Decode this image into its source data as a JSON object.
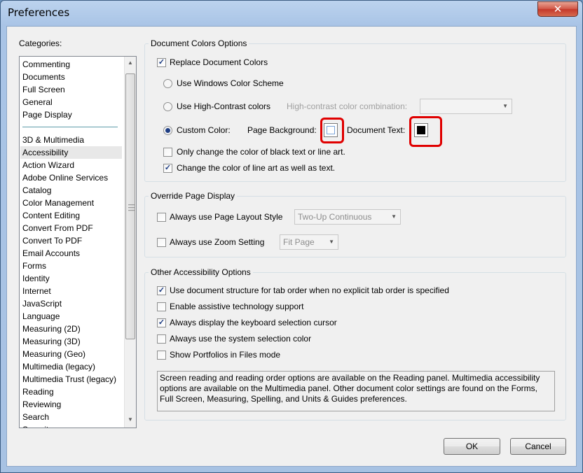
{
  "window": {
    "title": "Preferences",
    "close_glyph": "✕"
  },
  "categories": {
    "label": "Categories:",
    "group1": [
      "Commenting",
      "Documents",
      "Full Screen",
      "General",
      "Page Display"
    ],
    "group2": [
      "3D & Multimedia",
      "Accessibility",
      "Action Wizard",
      "Adobe Online Services",
      "Catalog",
      "Color Management",
      "Content Editing",
      "Convert From PDF",
      "Convert To PDF",
      "Email Accounts",
      "Forms",
      "Identity",
      "Internet",
      "JavaScript",
      "Language",
      "Measuring (2D)",
      "Measuring (3D)",
      "Measuring (Geo)",
      "Multimedia (legacy)",
      "Multimedia Trust (legacy)",
      "Reading",
      "Reviewing",
      "Search",
      "Security"
    ],
    "selected": "Accessibility"
  },
  "doc_colors": {
    "title": "Document Colors Options",
    "replace": {
      "label": "Replace Document Colors",
      "checked": true
    },
    "windows_scheme": {
      "label": "Use Windows Color Scheme",
      "selected": false
    },
    "high_contrast": {
      "label": "Use High-Contrast colors",
      "selected": false
    },
    "hc_combo_label": "High-contrast color combination:",
    "hc_combo_value": "",
    "custom": {
      "label": "Custom Color:",
      "selected": true
    },
    "page_bg_label": "Page Background:",
    "page_bg_color": "#ffffff",
    "doc_text_label": "Document Text:",
    "doc_text_color": "#000000",
    "only_black": {
      "label": "Only change the color of black text or line art.",
      "checked": false
    },
    "line_art": {
      "label": "Change the color of line art as well as text.",
      "checked": true
    }
  },
  "override": {
    "title": "Override Page Display",
    "page_layout": {
      "label": "Always use Page Layout Style",
      "checked": false,
      "value": "Two-Up Continuous"
    },
    "zoom": {
      "label": "Always use Zoom Setting",
      "checked": false,
      "value": "Fit Page"
    }
  },
  "other": {
    "title": "Other Accessibility Options",
    "options": [
      {
        "label": "Use document structure for tab order when no explicit tab order is specified",
        "checked": true
      },
      {
        "label": "Enable assistive technology support",
        "checked": false
      },
      {
        "label": "Always display the keyboard selection cursor",
        "checked": true
      },
      {
        "label": "Always use the system selection color",
        "checked": false
      },
      {
        "label": "Show Portfolios in Files mode",
        "checked": false
      }
    ],
    "note": "Screen reading and reading order options are available on the Reading panel. Multimedia accessibility options are available on the Multimedia panel. Other document color settings are found on the Forms, Full Screen, Measuring, Spelling, and Units & Guides preferences."
  },
  "buttons": {
    "ok": "OK",
    "cancel": "Cancel"
  },
  "colors": {
    "highlight": "#e00000",
    "check": "#1f3e84"
  },
  "icons": {
    "checkmark": "✓",
    "down": "▼",
    "up": "▲"
  }
}
